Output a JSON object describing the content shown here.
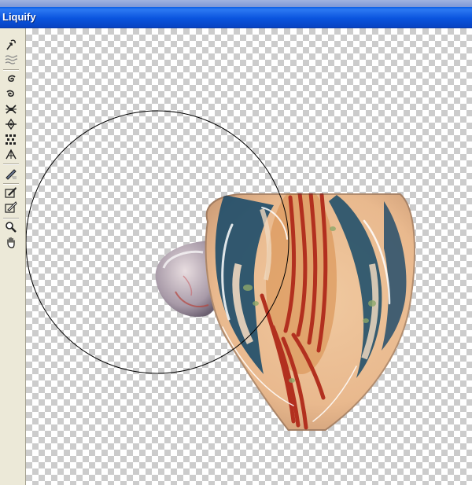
{
  "window": {
    "title": "Liquify"
  },
  "toolbar": {
    "tools": [
      {
        "name": "forward-warp-tool",
        "icon": "forward-warp-icon"
      },
      {
        "name": "turbulence-tool",
        "icon": "turbulence-icon"
      },
      {
        "name": "twirl-clockwise-tool",
        "icon": "twirl-clockwise-icon"
      },
      {
        "name": "twirl-counterclockwise-tool",
        "icon": "twirl-counterclockwise-icon"
      },
      {
        "name": "pucker-tool",
        "icon": "pucker-icon"
      },
      {
        "name": "bloat-tool",
        "icon": "bloat-icon"
      },
      {
        "name": "shift-pixels-tool",
        "icon": "shift-pixels-icon"
      },
      {
        "name": "reflection-tool",
        "icon": "reflection-icon"
      },
      {
        "name": "reconstruct-tool",
        "icon": "reconstruct-icon"
      },
      {
        "name": "freeze-mask-tool",
        "icon": "freeze-mask-icon"
      },
      {
        "name": "thaw-mask-tool",
        "icon": "thaw-mask-icon"
      },
      {
        "name": "zoom-tool",
        "icon": "magnifier-icon"
      },
      {
        "name": "hand-tool",
        "icon": "hand-icon"
      }
    ]
  },
  "colors": {
    "titlebar": "#0a54de",
    "glass_red": "#b2301f",
    "glass_blue": "#1d4d6a",
    "glass_cream": "#efd8bf"
  }
}
